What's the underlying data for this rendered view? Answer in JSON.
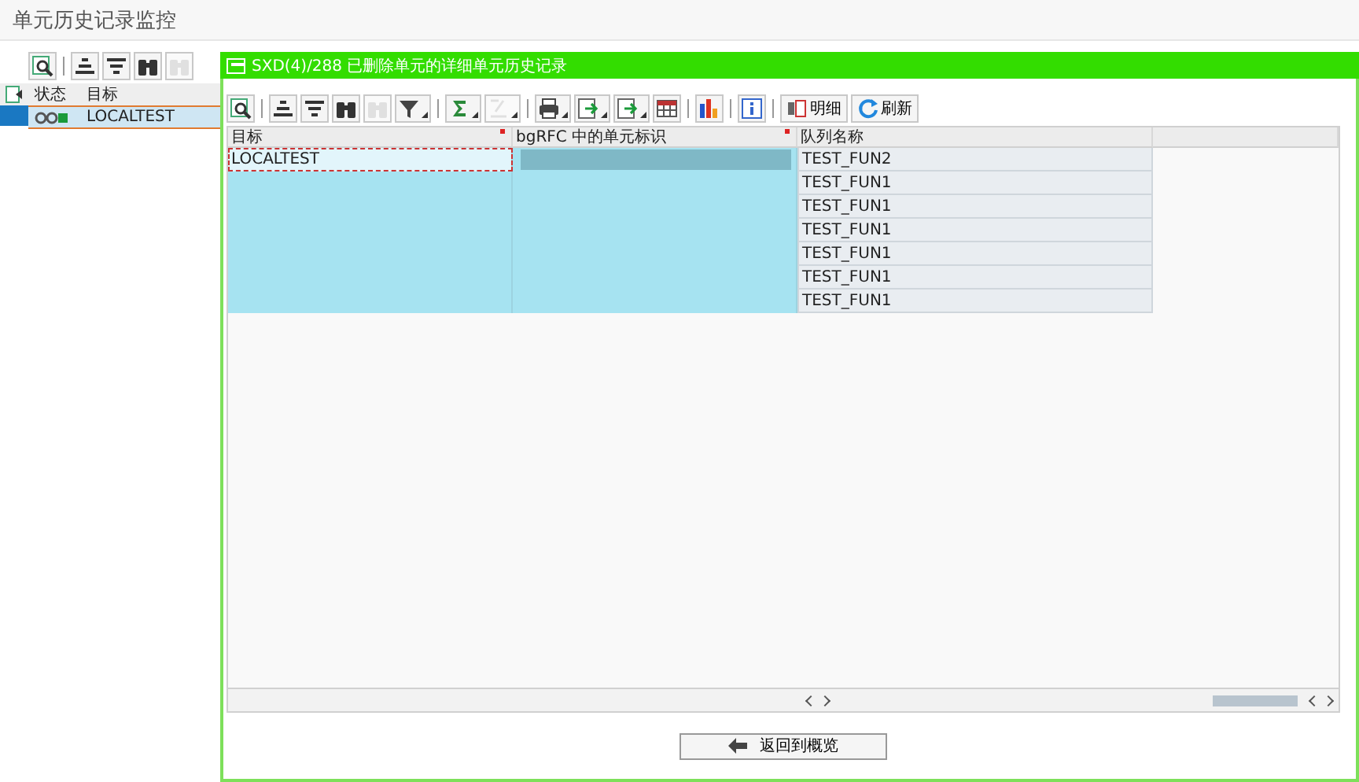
{
  "window": {
    "title": "单元历史记录监控"
  },
  "left_toolbar": [
    {
      "disabled": false
    },
    {
      "disabled": false
    },
    {
      "disabled": false
    },
    {
      "disabled": false
    },
    {
      "disabled": true
    }
  ],
  "left_table": {
    "columns": [
      "状态",
      "目标"
    ],
    "rows": [
      {
        "target": "LOCALTEST",
        "selected": true
      }
    ]
  },
  "dialog": {
    "title": "SXD(4)/288 已删除单元的详细单元历史记录",
    "toolbar": [
      {
        "disabled": false
      },
      {
        "disabled": false
      },
      {
        "disabled": false
      },
      {
        "disabled": false
      },
      {
        "disabled": true
      },
      {
        "disabled": false
      },
      {
        "disabled": false
      },
      {
        "disabled": true
      },
      {
        "disabled": false
      },
      {
        "disabled": false
      },
      {
        "disabled": false
      },
      {
        "disabled": false
      },
      {
        "disabled": false
      },
      {
        "disabled": false
      }
    ],
    "buttons": [
      {
        "label": "明细"
      },
      {
        "label": "刷新"
      }
    ],
    "table": {
      "columns": [
        {
          "label": "目标",
          "sorted": true
        },
        {
          "label": "bgRFC 中的单元标识",
          "sorted": true
        },
        {
          "label": "队列名称",
          "sorted": false
        }
      ],
      "rows": [
        {
          "target": "LOCALTEST",
          "focused": true,
          "redacted": true,
          "queue": "TEST_FUN2"
        },
        {
          "target": "",
          "focused": false,
          "redacted": false,
          "queue": "TEST_FUN1"
        },
        {
          "target": "",
          "focused": false,
          "redacted": false,
          "queue": "TEST_FUN1"
        },
        {
          "target": "",
          "focused": false,
          "redacted": false,
          "queue": "TEST_FUN1"
        },
        {
          "target": "",
          "focused": false,
          "redacted": false,
          "queue": "TEST_FUN1"
        },
        {
          "target": "",
          "focused": false,
          "redacted": false,
          "queue": "TEST_FUN1"
        },
        {
          "target": "",
          "focused": false,
          "redacted": false,
          "queue": "TEST_FUN1"
        }
      ]
    },
    "back_button": {
      "label": "返回到概览"
    }
  }
}
